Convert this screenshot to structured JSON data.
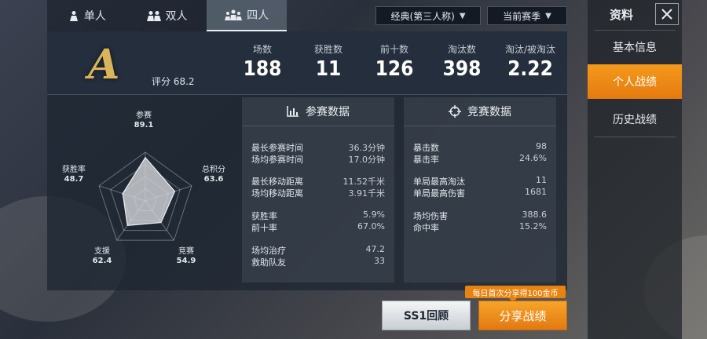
{
  "mode_tabs": [
    {
      "label": "单人",
      "icon": "single-player-icon"
    },
    {
      "label": "双人",
      "icon": "duo-icon"
    },
    {
      "label": "四人",
      "icon": "squad-icon",
      "active": true
    }
  ],
  "filters": {
    "perspective": "经典(第三人称)",
    "season": "当前赛季"
  },
  "side": {
    "title": "资料",
    "items": [
      {
        "label": "基本信息"
      },
      {
        "label": "个人战绩",
        "active": true
      },
      {
        "label": "历史战绩"
      }
    ]
  },
  "summary": {
    "grade": "A",
    "rating_label": "评分",
    "rating_value": "68.2",
    "stats": [
      {
        "label": "场数",
        "value": "188"
      },
      {
        "label": "获胜数",
        "value": "11"
      },
      {
        "label": "前十数",
        "value": "126"
      },
      {
        "label": "淘汰数",
        "value": "398"
      },
      {
        "label": "淘汰/被淘汰",
        "value": "2.22"
      }
    ]
  },
  "radar": {
    "axes": [
      {
        "label": "参赛",
        "value": "89.1",
        "v": 89.1
      },
      {
        "label": "总积分",
        "value": "63.6",
        "v": 63.6
      },
      {
        "label": "竞赛",
        "value": "54.9",
        "v": 54.9
      },
      {
        "label": "支援",
        "value": "62.4",
        "v": 62.4
      },
      {
        "label": "获胜率",
        "value": "48.7",
        "v": 48.7
      }
    ]
  },
  "participation": {
    "title": "参赛数据",
    "rows": [
      {
        "k": "最长参赛时间",
        "v": "36.3分钟"
      },
      {
        "k": "场均参赛时间",
        "v": "17.0分钟"
      },
      {
        "k": "最长移动距离",
        "v": "11.52千米"
      },
      {
        "k": "场均移动距离",
        "v": "3.91千米"
      },
      {
        "k": "获胜率",
        "v": "5.9%"
      },
      {
        "k": "前十率",
        "v": "67.0%"
      },
      {
        "k": "场均治疗",
        "v": "47.2"
      },
      {
        "k": "救助队友",
        "v": "33"
      }
    ]
  },
  "competition": {
    "title": "竞赛数据",
    "rows": [
      {
        "k": "暴击数",
        "v": "98"
      },
      {
        "k": "暴击率",
        "v": "24.6%"
      },
      {
        "k": "单局最高淘汰",
        "v": "11"
      },
      {
        "k": "单局最高伤害",
        "v": "1681"
      },
      {
        "k": "场均伤害",
        "v": "388.6"
      },
      {
        "k": "命中率",
        "v": "15.2%"
      }
    ]
  },
  "bottom": {
    "ss1_label": "SS1回顾",
    "share_label": "分享战绩",
    "share_tip": "每日首次分享得100金币"
  },
  "colors": {
    "accent": "#F08A14",
    "grade_gold": "#D9B45A"
  }
}
